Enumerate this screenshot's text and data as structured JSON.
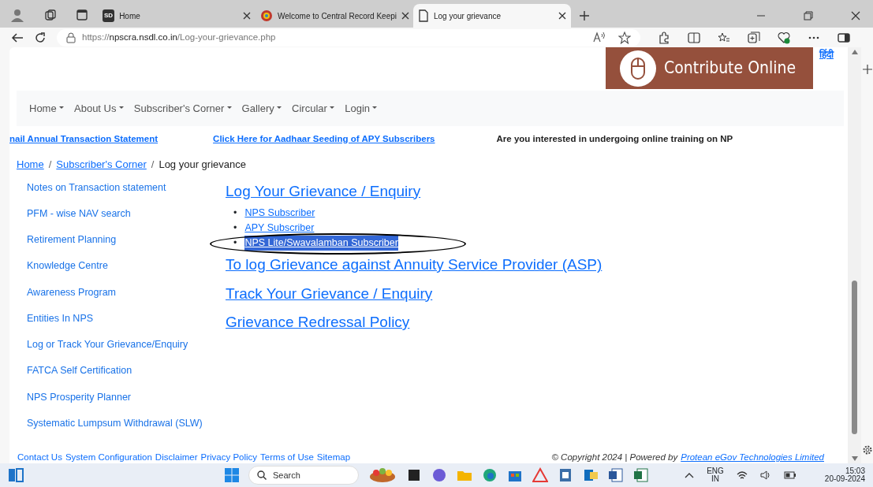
{
  "browser": {
    "tabs": [
      {
        "title": "Home",
        "selected": false
      },
      {
        "title": "Welcome to Central Record Keepi",
        "selected": false
      },
      {
        "title": "Log your grievance",
        "selected": true
      }
    ],
    "favicon_text": "SD",
    "url": {
      "scheme": "https://",
      "host": "npscra.nsdl.co.in",
      "path": "/Log-your-grievance.php"
    }
  },
  "header": {
    "banner_text": "Contribute Online",
    "language_link": "हिंदी"
  },
  "nav_items": [
    "Home",
    "About Us",
    "Subscriber's Corner",
    "Gallery",
    "Circular",
    "Login"
  ],
  "ticker": [
    {
      "text": "nail Annual Transaction Statement",
      "kind": "link"
    },
    {
      "text": "Click Here for Aadhaar Seeding of APY Subscribers",
      "kind": "link"
    },
    {
      "text": "Are you interested in undergoing online training on NP",
      "kind": "text"
    }
  ],
  "breadcrumb_separator": "/",
  "breadcrumb": [
    {
      "label": "Home",
      "current": false
    },
    {
      "label": "Subscriber's Corner",
      "current": false
    },
    {
      "label": "Log your grievance",
      "current": true
    }
  ],
  "sidebar_links": [
    "Notes on Transaction statement",
    "PFM - wise NAV search",
    "Retirement Planning",
    "Knowledge Centre",
    "Awareness Program",
    "Entities In NPS",
    "Log or Track Your Grievance/Enquiry",
    "FATCA Self Certification",
    "NPS Prosperity Planner",
    "Systematic Lumpsum Withdrawal (SLW)"
  ],
  "main": {
    "heading": "Log Your Grievance / Enquiry",
    "bullet": "•",
    "sub_links": [
      {
        "label": "NPS Subscriber",
        "highlighted": false,
        "circled": false
      },
      {
        "label": "APY Subscriber",
        "highlighted": false,
        "circled": false
      },
      {
        "label": "NPS Lite/Swavalamban Subscriber",
        "highlighted": true,
        "circled": true
      }
    ],
    "more_links": [
      "To log Grievance against Annuity Service Provider (ASP)",
      "Track Your Grievance / Enquiry",
      "Grievance Redressal Policy"
    ]
  },
  "footer": {
    "links": [
      "Contact Us",
      "System Configuration",
      "Disclaimer",
      "Privacy Policy",
      "Terms of Use",
      "Sitemap"
    ],
    "copyright": "© Copyright 2024 | Powered by",
    "company_link": "Protean eGov Technologies Limited"
  },
  "taskbar": {
    "search_placeholder": "Search",
    "language": "ENG",
    "region": "IN",
    "time": "15:03",
    "date": "20-09-2024"
  }
}
